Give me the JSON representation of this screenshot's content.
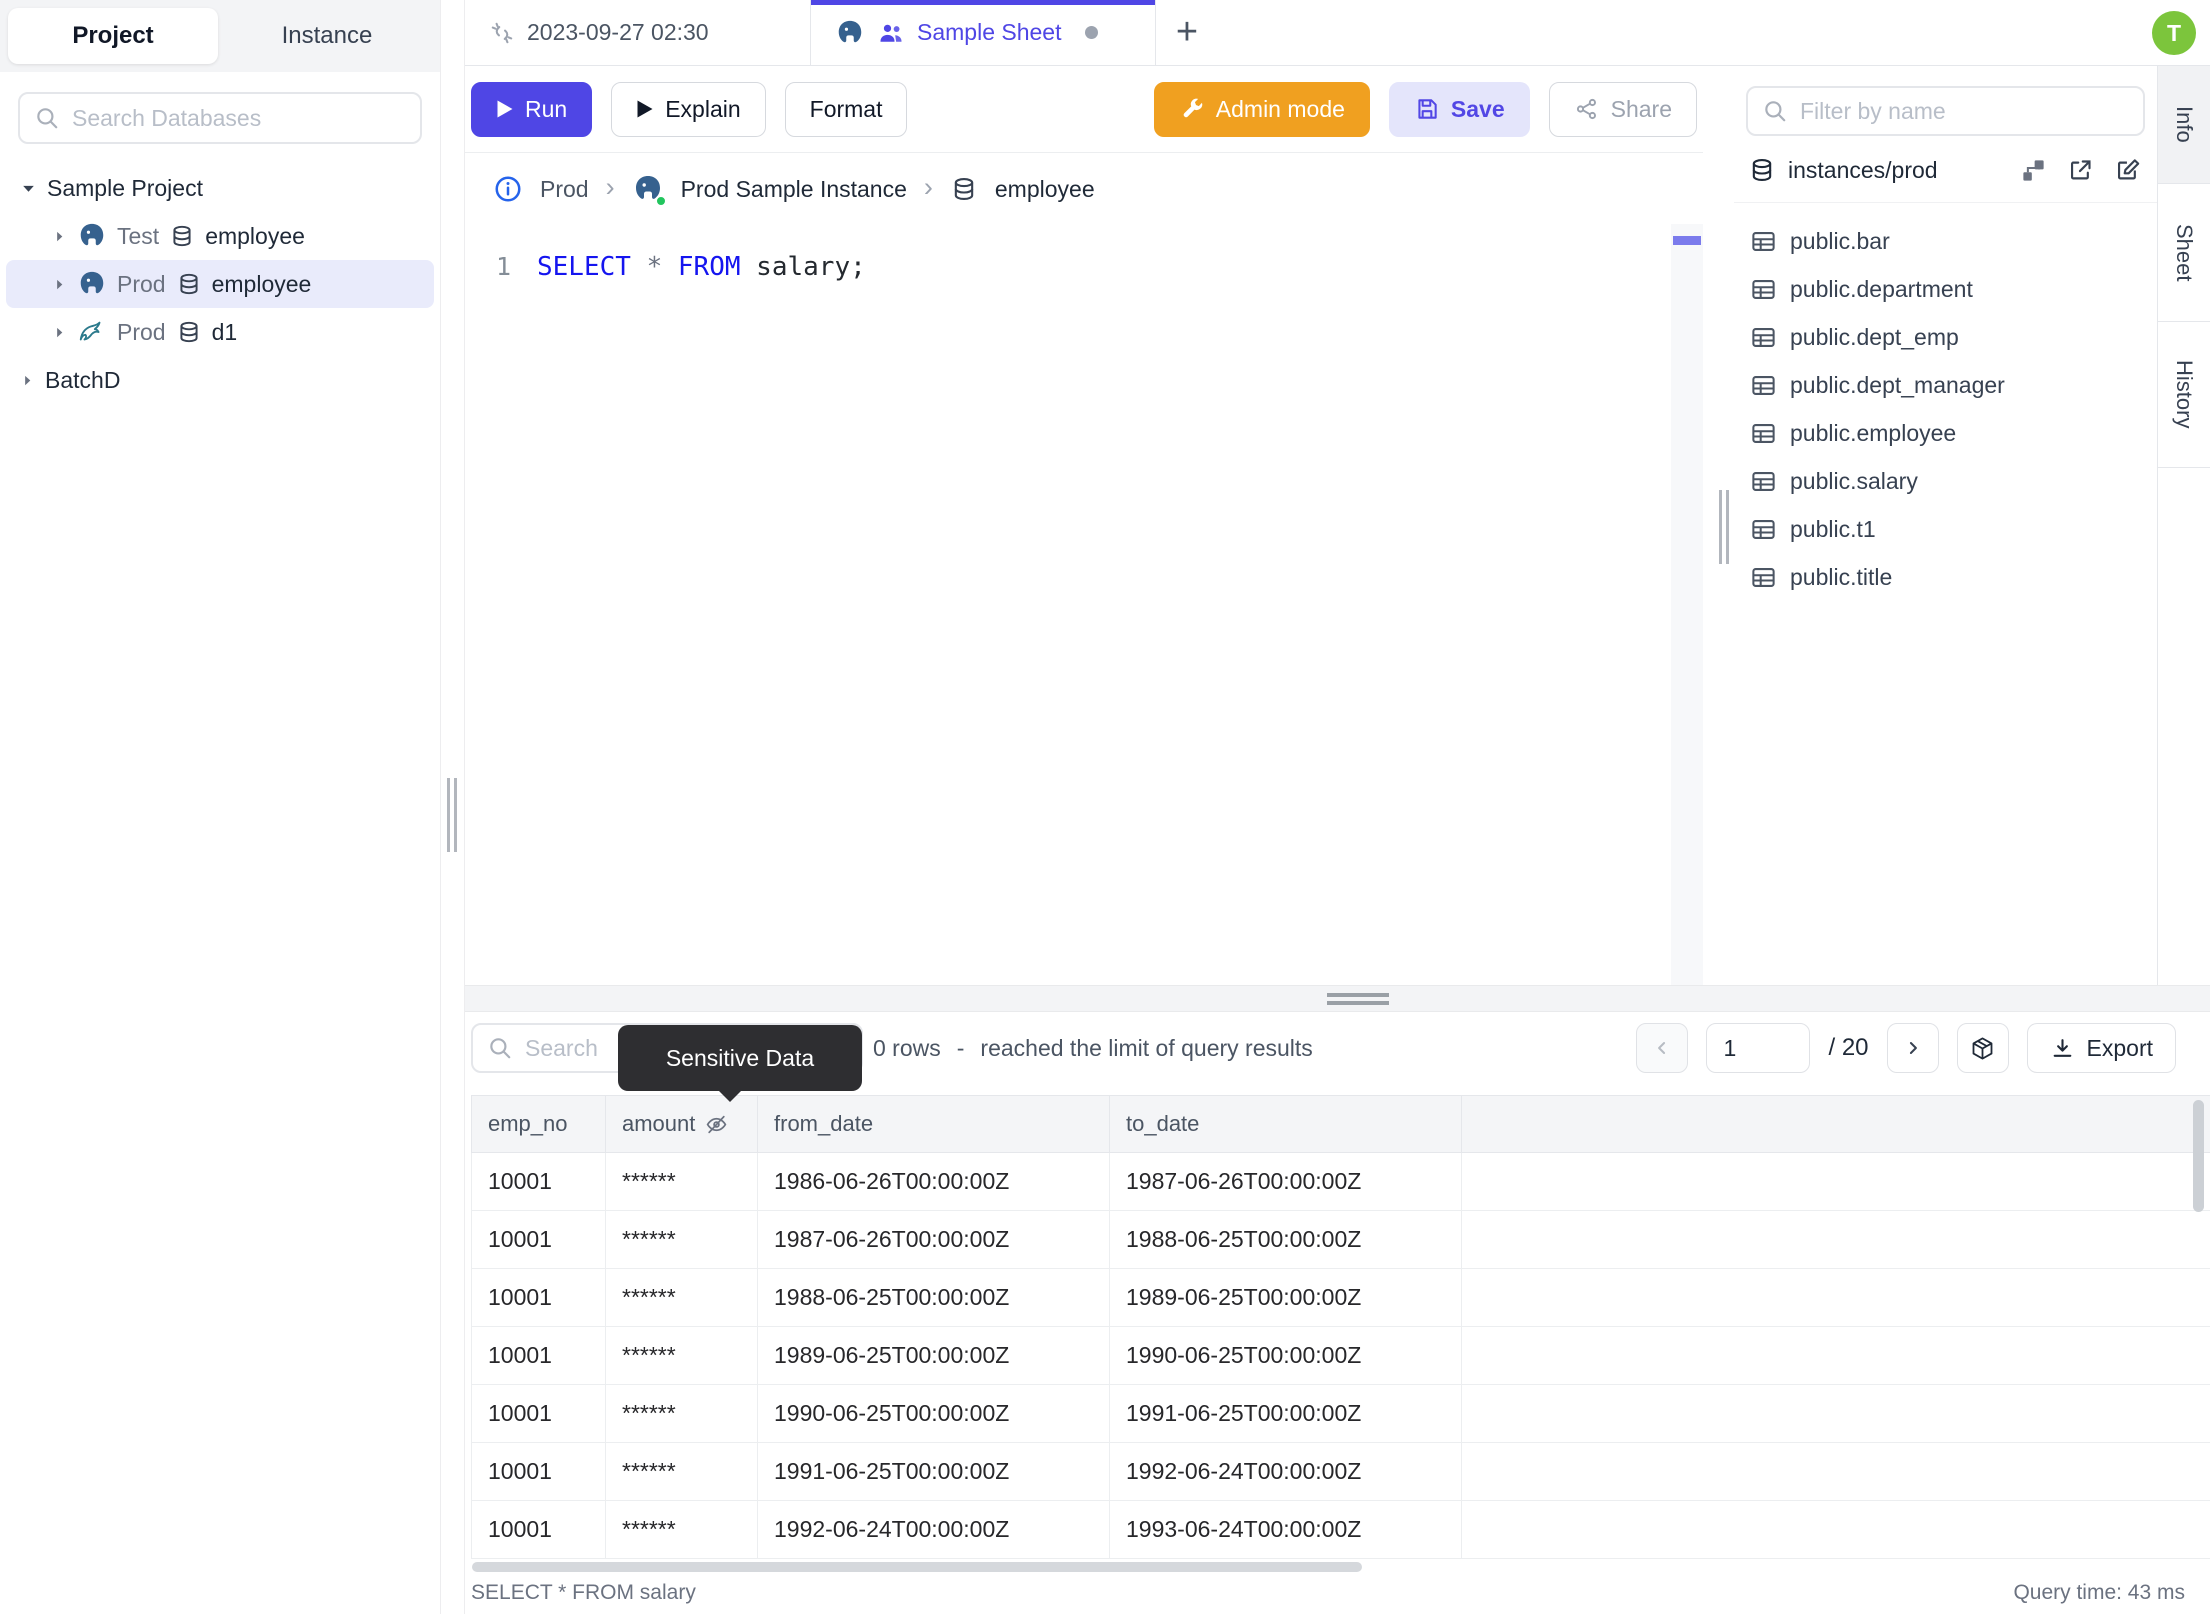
{
  "left_panel": {
    "tabs": {
      "project": "Project",
      "instance": "Instance"
    },
    "search_placeholder": "Search Databases",
    "tree": {
      "project1": "Sample Project",
      "node1": {
        "env": "Test",
        "db": "employee",
        "engine": "postgres"
      },
      "node2": {
        "env": "Prod",
        "db": "employee",
        "engine": "postgres",
        "selected": true
      },
      "node3": {
        "env": "Prod",
        "db": "d1",
        "engine": "mysql"
      },
      "project2": "BatchD"
    }
  },
  "tab_bar": {
    "tab1": "2023-09-27 02:30",
    "tab2": "Sample Sheet",
    "new_tab": "+",
    "avatar": "T"
  },
  "toolbar": {
    "run": "Run",
    "explain": "Explain",
    "format": "Format",
    "admin_mode": "Admin mode",
    "save": "Save",
    "share": "Share"
  },
  "breadcrumb": {
    "env": "Prod",
    "instance": "Prod Sample Instance",
    "db": "employee",
    "sep": "›"
  },
  "editor": {
    "line_no": "1",
    "kw1": "SELECT",
    "op": "*",
    "kw2": "FROM",
    "rest": "salary;"
  },
  "right_panel": {
    "filter_placeholder": "Filter by name",
    "instance_path": "instances/prod",
    "tables": [
      "public.bar",
      "public.department",
      "public.dept_emp",
      "public.dept_manager",
      "public.employee",
      "public.salary",
      "public.t1",
      "public.title"
    ]
  },
  "side_tabs": {
    "info": "Info",
    "sheet": "Sheet",
    "history": "History"
  },
  "results": {
    "search_placeholder": "Search",
    "tooltip": "Sensitive Data",
    "row_count": "0 rows",
    "dash": "-",
    "limit_text": "reached the limit of query results",
    "page": "1",
    "page_total": "/ 20",
    "export": "Export",
    "columns": [
      "emp_no",
      "amount",
      "from_date",
      "to_date"
    ],
    "rows": [
      [
        "10001",
        "******",
        "1986-06-26T00:00:00Z",
        "1987-06-26T00:00:00Z"
      ],
      [
        "10001",
        "******",
        "1987-06-26T00:00:00Z",
        "1988-06-25T00:00:00Z"
      ],
      [
        "10001",
        "******",
        "1988-06-25T00:00:00Z",
        "1989-06-25T00:00:00Z"
      ],
      [
        "10001",
        "******",
        "1989-06-25T00:00:00Z",
        "1990-06-25T00:00:00Z"
      ],
      [
        "10001",
        "******",
        "1990-06-25T00:00:00Z",
        "1991-06-25T00:00:00Z"
      ],
      [
        "10001",
        "******",
        "1991-06-25T00:00:00Z",
        "1992-06-24T00:00:00Z"
      ],
      [
        "10001",
        "******",
        "1992-06-24T00:00:00Z",
        "1993-06-24T00:00:00Z"
      ]
    ]
  },
  "status_bar": {
    "query": "SELECT * FROM salary",
    "time": "Query time: 43 ms"
  },
  "colors": {
    "accent": "#4f46e5",
    "admin_orange": "#f0a020",
    "save_bg": "#e4e5fb",
    "avatar_green": "#7cc53c",
    "keyword_blue": "#1515ef",
    "selected_row_bg": "#e9ebfb",
    "tooltip_bg": "#2e2e31",
    "status_green": "#22c55e"
  }
}
